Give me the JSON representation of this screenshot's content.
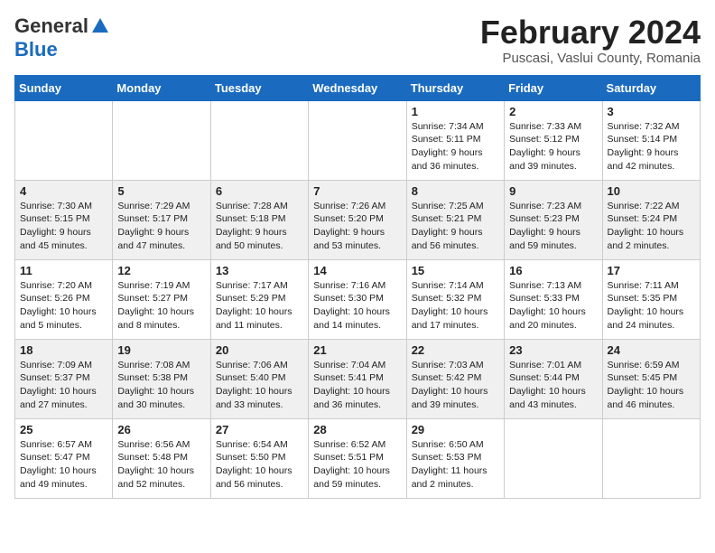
{
  "header": {
    "logo_general": "General",
    "logo_blue": "Blue",
    "month": "February 2024",
    "location": "Puscasi, Vaslui County, Romania"
  },
  "days_of_week": [
    "Sunday",
    "Monday",
    "Tuesday",
    "Wednesday",
    "Thursday",
    "Friday",
    "Saturday"
  ],
  "weeks": [
    [
      {
        "day": "",
        "text": ""
      },
      {
        "day": "",
        "text": ""
      },
      {
        "day": "",
        "text": ""
      },
      {
        "day": "",
        "text": ""
      },
      {
        "day": "1",
        "text": "Sunrise: 7:34 AM\nSunset: 5:11 PM\nDaylight: 9 hours\nand 36 minutes."
      },
      {
        "day": "2",
        "text": "Sunrise: 7:33 AM\nSunset: 5:12 PM\nDaylight: 9 hours\nand 39 minutes."
      },
      {
        "day": "3",
        "text": "Sunrise: 7:32 AM\nSunset: 5:14 PM\nDaylight: 9 hours\nand 42 minutes."
      }
    ],
    [
      {
        "day": "4",
        "text": "Sunrise: 7:30 AM\nSunset: 5:15 PM\nDaylight: 9 hours\nand 45 minutes."
      },
      {
        "day": "5",
        "text": "Sunrise: 7:29 AM\nSunset: 5:17 PM\nDaylight: 9 hours\nand 47 minutes."
      },
      {
        "day": "6",
        "text": "Sunrise: 7:28 AM\nSunset: 5:18 PM\nDaylight: 9 hours\nand 50 minutes."
      },
      {
        "day": "7",
        "text": "Sunrise: 7:26 AM\nSunset: 5:20 PM\nDaylight: 9 hours\nand 53 minutes."
      },
      {
        "day": "8",
        "text": "Sunrise: 7:25 AM\nSunset: 5:21 PM\nDaylight: 9 hours\nand 56 minutes."
      },
      {
        "day": "9",
        "text": "Sunrise: 7:23 AM\nSunset: 5:23 PM\nDaylight: 9 hours\nand 59 minutes."
      },
      {
        "day": "10",
        "text": "Sunrise: 7:22 AM\nSunset: 5:24 PM\nDaylight: 10 hours\nand 2 minutes."
      }
    ],
    [
      {
        "day": "11",
        "text": "Sunrise: 7:20 AM\nSunset: 5:26 PM\nDaylight: 10 hours\nand 5 minutes."
      },
      {
        "day": "12",
        "text": "Sunrise: 7:19 AM\nSunset: 5:27 PM\nDaylight: 10 hours\nand 8 minutes."
      },
      {
        "day": "13",
        "text": "Sunrise: 7:17 AM\nSunset: 5:29 PM\nDaylight: 10 hours\nand 11 minutes."
      },
      {
        "day": "14",
        "text": "Sunrise: 7:16 AM\nSunset: 5:30 PM\nDaylight: 10 hours\nand 14 minutes."
      },
      {
        "day": "15",
        "text": "Sunrise: 7:14 AM\nSunset: 5:32 PM\nDaylight: 10 hours\nand 17 minutes."
      },
      {
        "day": "16",
        "text": "Sunrise: 7:13 AM\nSunset: 5:33 PM\nDaylight: 10 hours\nand 20 minutes."
      },
      {
        "day": "17",
        "text": "Sunrise: 7:11 AM\nSunset: 5:35 PM\nDaylight: 10 hours\nand 24 minutes."
      }
    ],
    [
      {
        "day": "18",
        "text": "Sunrise: 7:09 AM\nSunset: 5:37 PM\nDaylight: 10 hours\nand 27 minutes."
      },
      {
        "day": "19",
        "text": "Sunrise: 7:08 AM\nSunset: 5:38 PM\nDaylight: 10 hours\nand 30 minutes."
      },
      {
        "day": "20",
        "text": "Sunrise: 7:06 AM\nSunset: 5:40 PM\nDaylight: 10 hours\nand 33 minutes."
      },
      {
        "day": "21",
        "text": "Sunrise: 7:04 AM\nSunset: 5:41 PM\nDaylight: 10 hours\nand 36 minutes."
      },
      {
        "day": "22",
        "text": "Sunrise: 7:03 AM\nSunset: 5:42 PM\nDaylight: 10 hours\nand 39 minutes."
      },
      {
        "day": "23",
        "text": "Sunrise: 7:01 AM\nSunset: 5:44 PM\nDaylight: 10 hours\nand 43 minutes."
      },
      {
        "day": "24",
        "text": "Sunrise: 6:59 AM\nSunset: 5:45 PM\nDaylight: 10 hours\nand 46 minutes."
      }
    ],
    [
      {
        "day": "25",
        "text": "Sunrise: 6:57 AM\nSunset: 5:47 PM\nDaylight: 10 hours\nand 49 minutes."
      },
      {
        "day": "26",
        "text": "Sunrise: 6:56 AM\nSunset: 5:48 PM\nDaylight: 10 hours\nand 52 minutes."
      },
      {
        "day": "27",
        "text": "Sunrise: 6:54 AM\nSunset: 5:50 PM\nDaylight: 10 hours\nand 56 minutes."
      },
      {
        "day": "28",
        "text": "Sunrise: 6:52 AM\nSunset: 5:51 PM\nDaylight: 10 hours\nand 59 minutes."
      },
      {
        "day": "29",
        "text": "Sunrise: 6:50 AM\nSunset: 5:53 PM\nDaylight: 11 hours\nand 2 minutes."
      },
      {
        "day": "",
        "text": ""
      },
      {
        "day": "",
        "text": ""
      }
    ]
  ]
}
